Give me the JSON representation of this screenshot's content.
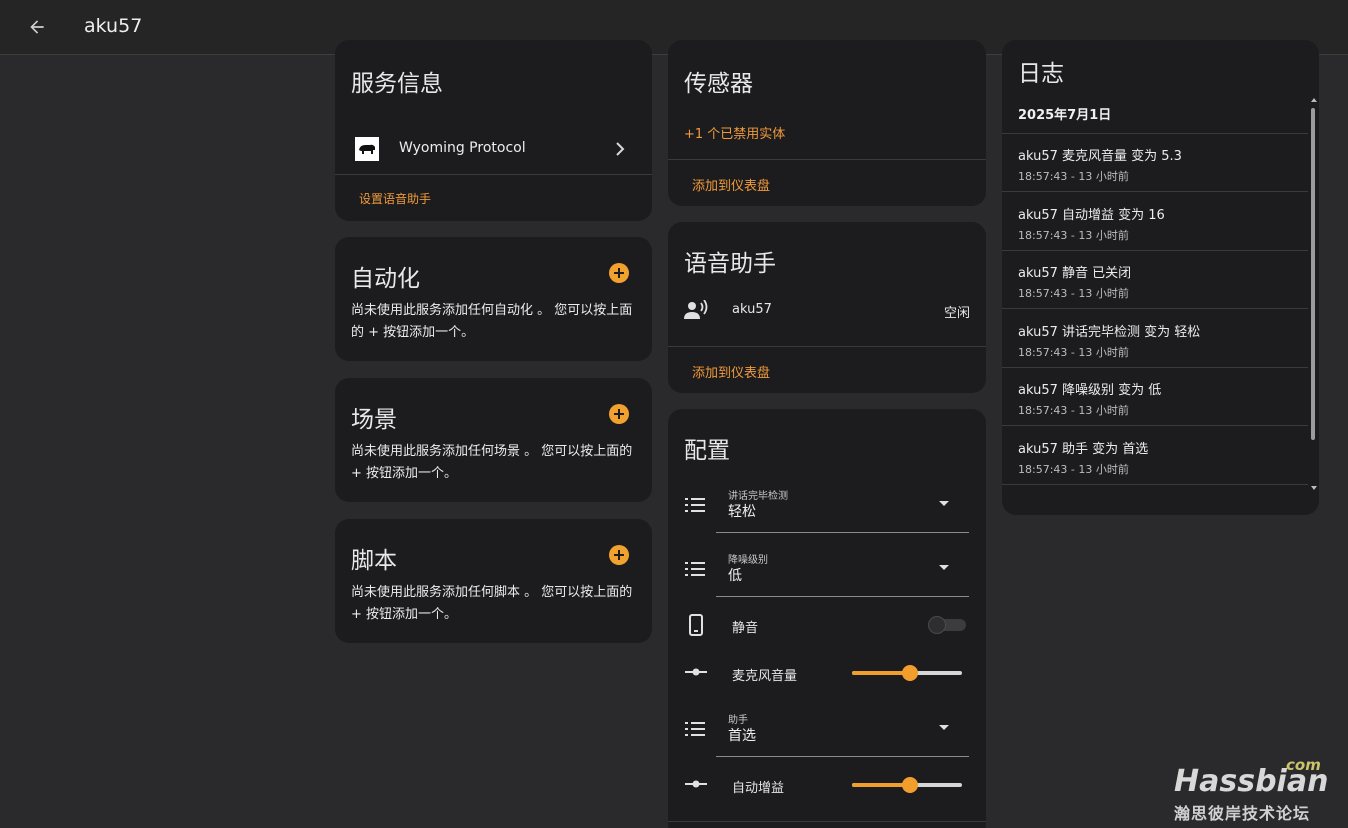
{
  "header": {
    "title": "aku57"
  },
  "service_info": {
    "title": "服务信息",
    "integration_name": "Wyoming Protocol",
    "setup_link": "设置语音助手"
  },
  "automation": {
    "title": "自动化",
    "description": "尚未使用此服务添加任何自动化 。 您可以按上面的 + 按钮添加一个。"
  },
  "scene": {
    "title": "场景",
    "description": "尚未使用此服务添加任何场景 。 您可以按上面的 + 按钮添加一个。"
  },
  "script": {
    "title": "脚本",
    "description": "尚未使用此服务添加任何脚本 。 您可以按上面的 + 按钮添加一个。"
  },
  "sensors": {
    "title": "传感器",
    "disabled_entities": "+1 个已禁用实体",
    "add_to_dashboard": "添加到仪表盘"
  },
  "voice_assistant": {
    "title": "语音助手",
    "entity_name": "aku57",
    "entity_state": "空闲",
    "add_to_dashboard": "添加到仪表盘"
  },
  "config": {
    "title": "配置",
    "finished_speaking": {
      "label": "讲话完毕检测",
      "value": "轻松"
    },
    "noise_suppression": {
      "label": "降噪级别",
      "value": "低"
    },
    "mute": {
      "label": "静音",
      "state": "off"
    },
    "mic_volume": {
      "label": "麦克风音量",
      "value": 0.53
    },
    "assistant": {
      "label": "助手",
      "value": "首选"
    },
    "auto_gain": {
      "label": "自动增益",
      "value": 0.53
    }
  },
  "logbook": {
    "title": "日志",
    "date": "2025年7月1日",
    "entries": [
      {
        "title": "aku57 麦克风音量 变为 5.3",
        "time": "18:57:43 - 13 小时前"
      },
      {
        "title": "aku57 自动增益 变为 16",
        "time": "18:57:43 - 13 小时前"
      },
      {
        "title": "aku57 静音 已关闭",
        "time": "18:57:43 - 13 小时前"
      },
      {
        "title": "aku57 讲话完毕检测 变为 轻松",
        "time": "18:57:43 - 13 小时前"
      },
      {
        "title": "aku57 降噪级别 变为 低",
        "time": "18:57:43 - 13 小时前"
      },
      {
        "title": "aku57 助手 变为 首选",
        "time": "18:57:43 - 13 小时前"
      }
    ]
  },
  "watermark": {
    "brand": "Hassbian",
    "suffix": "com",
    "tagline": "瀚思彼岸技术论坛"
  },
  "colors": {
    "accent": "#f29e2c",
    "link": "#f19a3b",
    "card": "#1c1c1e",
    "background": "#2a2a2c"
  }
}
